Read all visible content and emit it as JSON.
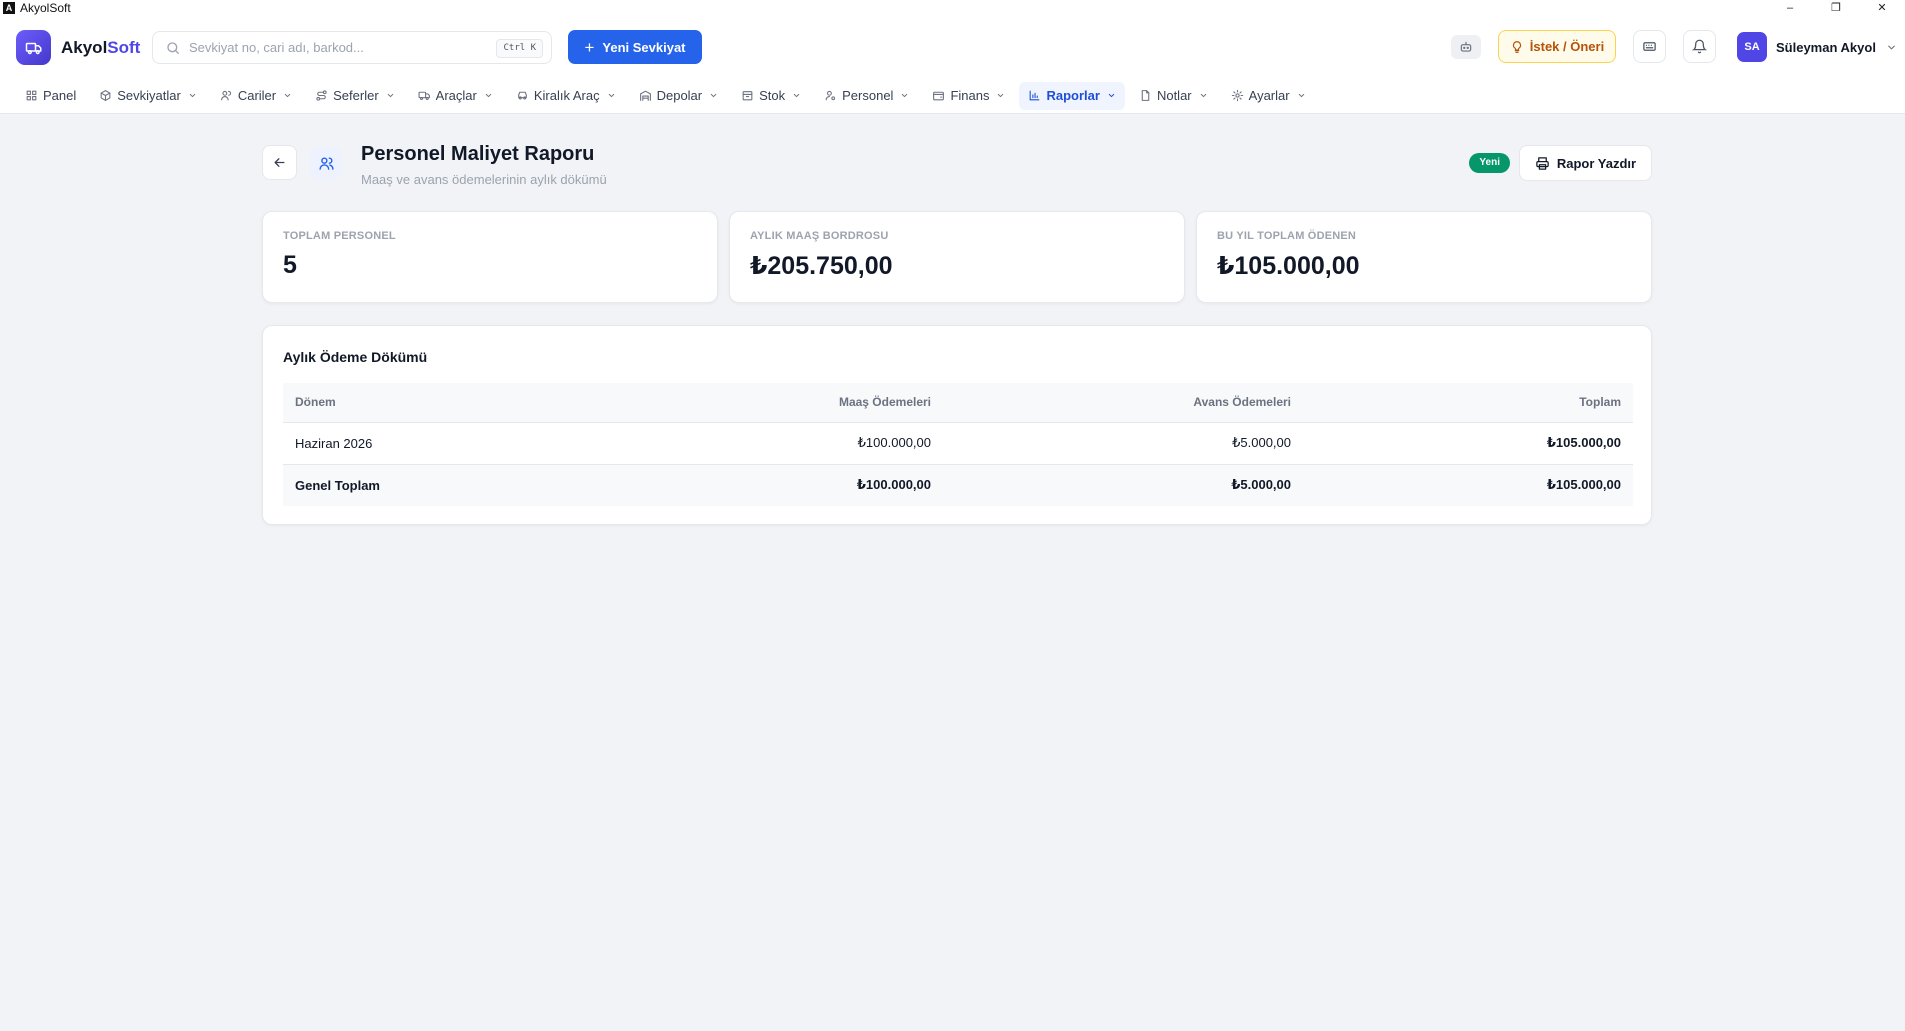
{
  "window": {
    "title": "AkyolSoft",
    "controls": {
      "minimize": "–",
      "restore": "❐",
      "close": "✕"
    }
  },
  "header": {
    "brand_primary": "Akyol",
    "brand_secondary": "Soft",
    "search": {
      "placeholder": "Sevkiyat no, cari adı, barkod...",
      "value": "",
      "shortcut": "Ctrl K"
    },
    "new_button": {
      "icon": "+",
      "label": "Yeni Sevkiyat"
    },
    "idea_button": {
      "label": "İstek / Öneri"
    },
    "user": {
      "initials": "SA",
      "name": "Süleyman Akyol"
    },
    "accent_color": "#2563eb",
    "brand_color": "#4f46e5"
  },
  "nav": {
    "items": [
      {
        "label": "Panel",
        "icon": "grid-icon",
        "dropdown": false,
        "active": false
      },
      {
        "label": "Sevkiyatlar",
        "icon": "package-icon",
        "dropdown": true,
        "active": false
      },
      {
        "label": "Cariler",
        "icon": "users-icon",
        "dropdown": true,
        "active": false
      },
      {
        "label": "Seferler",
        "icon": "route-icon",
        "dropdown": true,
        "active": false
      },
      {
        "label": "Araçlar",
        "icon": "truck-icon",
        "dropdown": true,
        "active": false
      },
      {
        "label": "Kiralık Araç",
        "icon": "car-icon",
        "dropdown": true,
        "active": false
      },
      {
        "label": "Depolar",
        "icon": "warehouse-icon",
        "dropdown": true,
        "active": false
      },
      {
        "label": "Stok",
        "icon": "box-icon",
        "dropdown": true,
        "active": false
      },
      {
        "label": "Personel",
        "icon": "user-cog-icon",
        "dropdown": true,
        "active": false
      },
      {
        "label": "Finans",
        "icon": "wallet-icon",
        "dropdown": true,
        "active": false
      },
      {
        "label": "Raporlar",
        "icon": "bar-chart-icon",
        "dropdown": true,
        "active": true
      },
      {
        "label": "Notlar",
        "icon": "file-icon",
        "dropdown": true,
        "active": false
      },
      {
        "label": "Ayarlar",
        "icon": "gear-icon",
        "dropdown": true,
        "active": false
      }
    ]
  },
  "page": {
    "title": "Personel Maliyet Raporu",
    "subtitle": "Maaş ve avans ödemelerinin aylık dökümü",
    "badge": "Yeni",
    "print_label": "Rapor Yazdır",
    "badge_color": "#059669"
  },
  "stats": [
    {
      "label": "Toplam Personel",
      "value": "5"
    },
    {
      "label": "Aylık Maaş Bordrosu",
      "value": "₺205.750,00"
    },
    {
      "label": "Bu Yıl Toplam Ödenen",
      "value": "₺105.000,00"
    }
  ],
  "table": {
    "title": "Aylık Ödeme Dökümü",
    "columns": [
      "Dönem",
      "Maaş Ödemeleri",
      "Avans Ödemeleri",
      "Toplam"
    ],
    "rows": [
      [
        "Haziran 2026",
        "₺100.000,00",
        "₺5.000,00",
        "₺105.000,00"
      ]
    ],
    "total_row": [
      "Genel Toplam",
      "₺100.000,00",
      "₺5.000,00",
      "₺105.000,00"
    ]
  }
}
